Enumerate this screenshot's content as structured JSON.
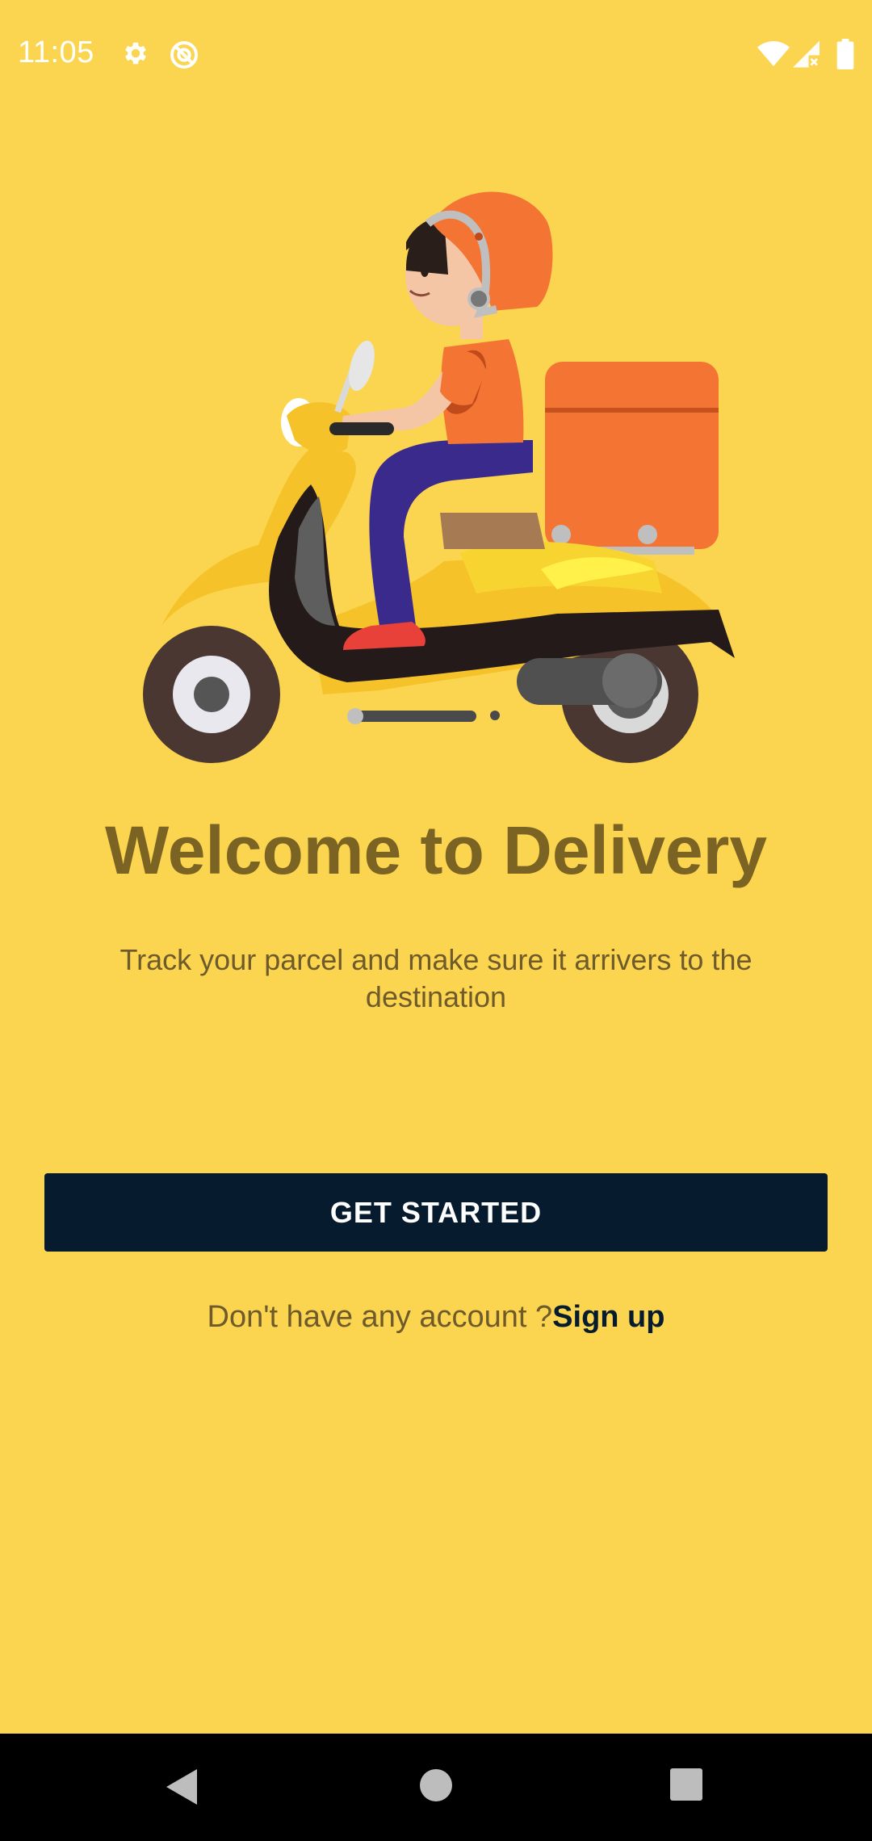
{
  "status_bar": {
    "time": "11:05",
    "left_icons": [
      "gear-icon",
      "do-not-disturb-icon"
    ],
    "right_icons": [
      "wifi-icon",
      "signal-icon",
      "battery-icon"
    ]
  },
  "hero": {
    "illustration": "delivery-scooter-rider"
  },
  "welcome": {
    "title": "Welcome to Delivery",
    "subtitle": "Track your parcel and make sure it arrivers to the destination"
  },
  "actions": {
    "get_started_label": "GET STARTED",
    "signup_prompt": "Don't have any account ?",
    "signup_link": "Sign up"
  },
  "nav_bar": {
    "buttons": [
      "back-icon",
      "home-icon",
      "recents-icon"
    ]
  },
  "colors": {
    "background": "#FBD54F",
    "title": "#7A6323",
    "button": "#061C2E",
    "button_text": "#FFFFFF"
  }
}
